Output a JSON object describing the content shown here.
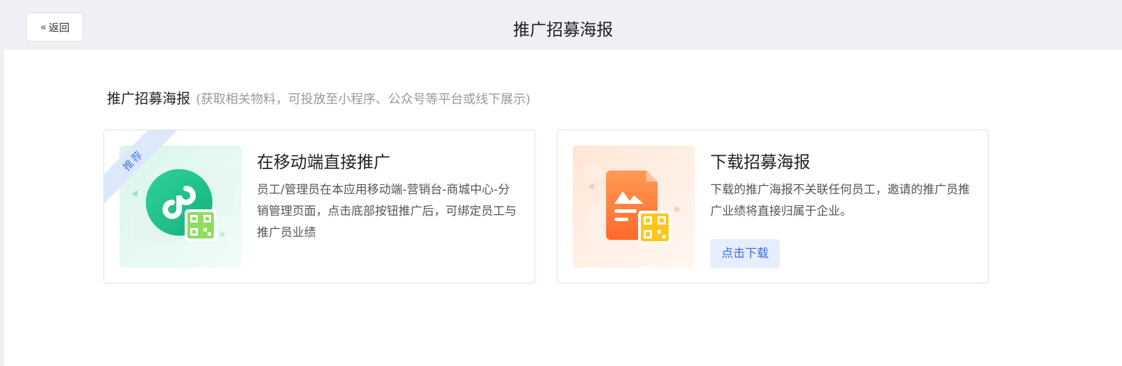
{
  "header": {
    "back_label": "返回",
    "title": "推广招募海报"
  },
  "section": {
    "title": "推广招募海报",
    "note": "(获取相关物料，可投放至小程序、公众号等平台或线下展示)"
  },
  "cards": [
    {
      "badge": "推荐",
      "title": "在移动端直接推广",
      "description": "员工/管理员在本应用移动端-营销台-商城中心-分销管理页面，点击底部按钮推广后，可绑定员工与推广员业绩",
      "icon": "mini-program-qr-icon"
    },
    {
      "title": "下载招募海报",
      "description": "下载的推广海报不关联任何员工，邀请的推广员推广业绩将直接归属于企业。",
      "button_label": "点击下载",
      "icon": "poster-qr-icon"
    }
  ],
  "colors": {
    "accent": "#3a6fe2",
    "green": "#1fbf8a",
    "orange": "#ff7a3d",
    "badge_bg": "#dde8fb"
  }
}
